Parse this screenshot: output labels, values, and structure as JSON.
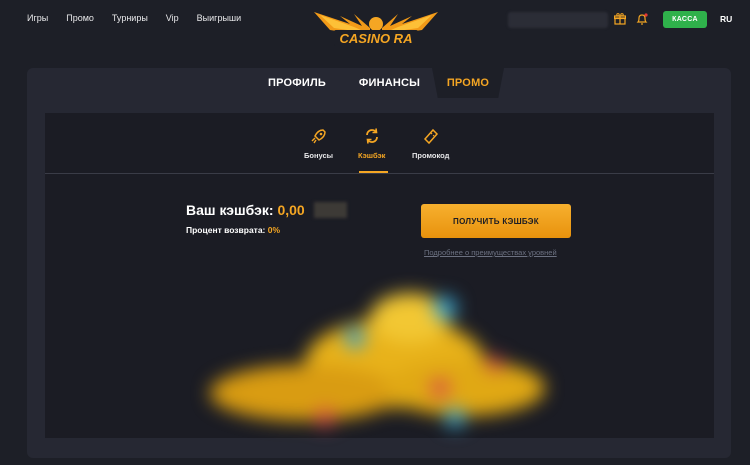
{
  "nav": {
    "items": [
      "Игры",
      "Промо",
      "Турниры",
      "Vip",
      "Выигрыши"
    ]
  },
  "logo": {
    "text": "CASINO RA"
  },
  "header": {
    "kassa_label": "КАССА",
    "lang": "RU"
  },
  "tabs": [
    {
      "label": "ПРОФИЛЬ",
      "active": false
    },
    {
      "label": "ФИНАНСЫ",
      "active": false
    },
    {
      "label": "ПРОМО",
      "active": true
    }
  ],
  "subtabs": [
    {
      "label": "Бонусы",
      "icon": "rocket-icon",
      "active": false
    },
    {
      "label": "Кэшбэк",
      "icon": "refresh-icon",
      "active": true
    },
    {
      "label": "Промокод",
      "icon": "ticket-icon",
      "active": false
    }
  ],
  "cashback": {
    "title_prefix": "Ваш кэшбэк: ",
    "value": "0,00",
    "percent_label": "Процент возврата: ",
    "percent_value": "0%",
    "button_label": "ПОЛУЧИТЬ КЭШБЭК",
    "more_link": "Подробнее о преимуществах уровней"
  },
  "colors": {
    "accent": "#f5a623",
    "kassa": "#2fb14b",
    "bg": "#1d1f27",
    "panel": "#262833"
  }
}
